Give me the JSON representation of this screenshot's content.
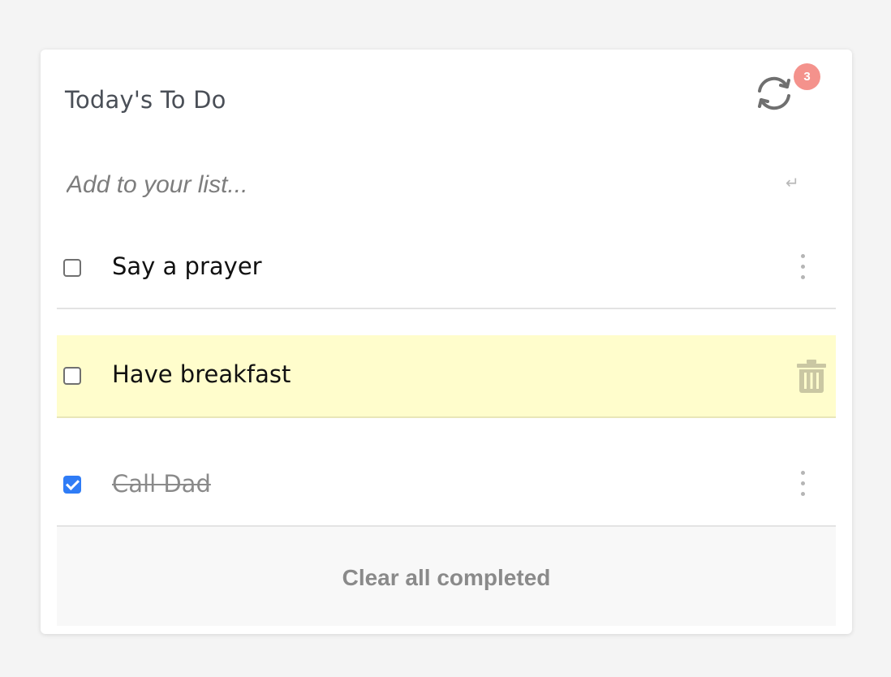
{
  "header": {
    "title": "Today's To Do",
    "sync_icon": "sync-icon",
    "badge_count": "3",
    "badge_color": "#f4928c"
  },
  "add": {
    "placeholder": "Add to your list...",
    "value": "",
    "enter_icon": "↵"
  },
  "todos": [
    {
      "text": "Say a prayer",
      "completed": false,
      "highlighted": false,
      "action_icon": "more-vertical-icon"
    },
    {
      "text": "Have breakfast",
      "completed": false,
      "highlighted": true,
      "action_icon": "trash-icon"
    },
    {
      "text": "Call Dad",
      "completed": true,
      "highlighted": false,
      "action_icon": "more-vertical-icon"
    }
  ],
  "footer": {
    "clear_label": "Clear all completed"
  },
  "colors": {
    "accent": "#2f7cf6",
    "highlight": "#fffdcc"
  }
}
